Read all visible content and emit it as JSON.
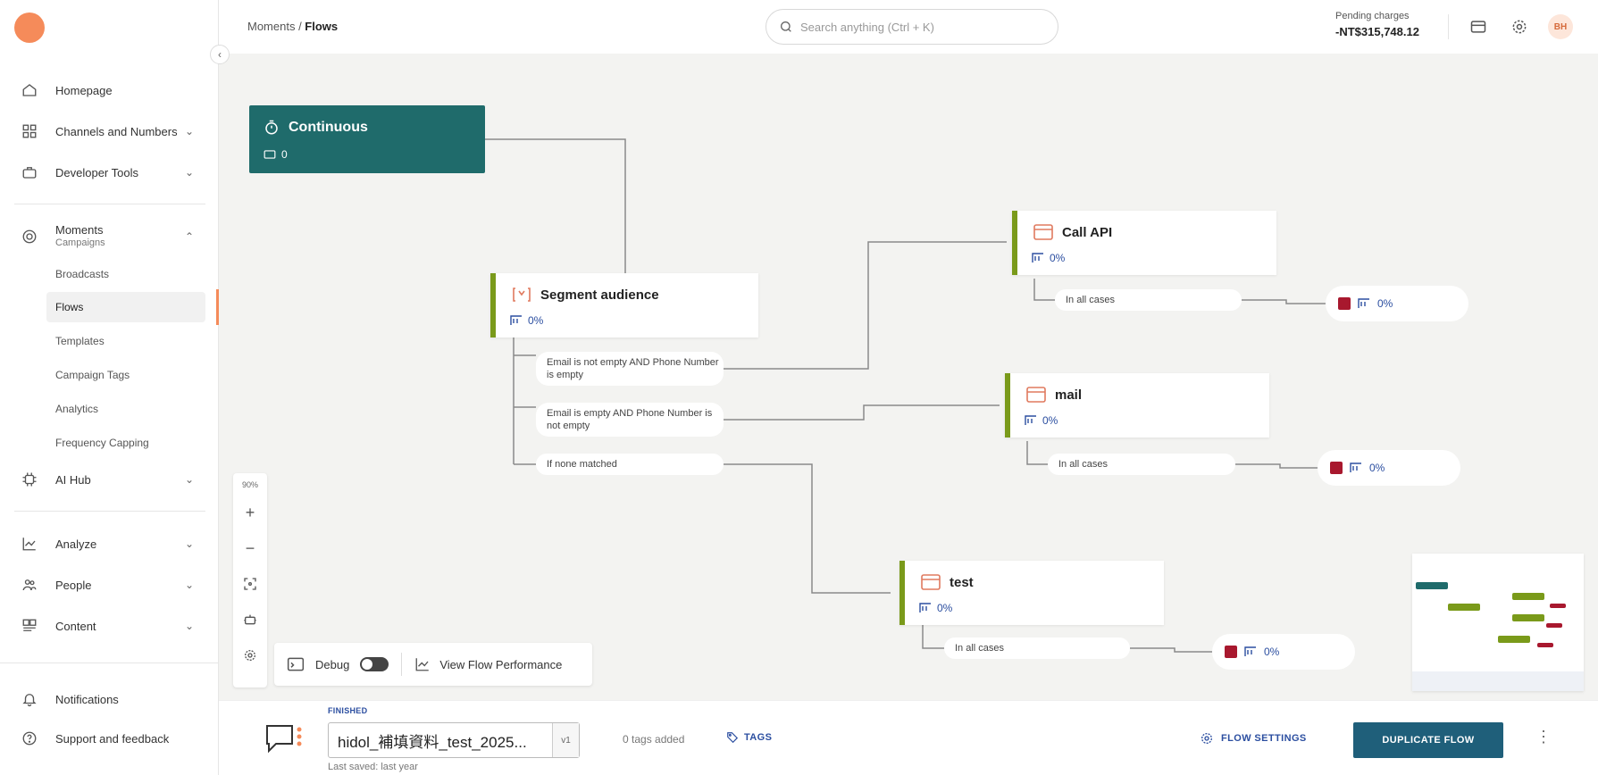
{
  "sidebar": {
    "items": [
      {
        "label": "Homepage",
        "icon": "home-icon"
      },
      {
        "label": "Channels and Numbers",
        "icon": "grid-icon"
      },
      {
        "label": "Developer Tools",
        "icon": "toolbox-icon"
      },
      {
        "label": "Moments",
        "sub": "Campaigns",
        "icon": "target-icon"
      },
      {
        "label": "AI Hub",
        "icon": "chip-icon"
      },
      {
        "label": "Analyze",
        "icon": "chart-icon"
      },
      {
        "label": "People",
        "icon": "people-icon"
      },
      {
        "label": "Content",
        "icon": "content-icon"
      }
    ],
    "moments_sub": [
      "Broadcasts",
      "Flows",
      "Templates",
      "Campaign Tags",
      "Analytics",
      "Frequency Capping"
    ],
    "bottom": [
      {
        "label": "Notifications",
        "icon": "bell-icon"
      },
      {
        "label": "Support and feedback",
        "icon": "help-icon"
      }
    ]
  },
  "header": {
    "breadcrumb_parent": "Moments / ",
    "breadcrumb_current": "Flows",
    "search_placeholder": "Search anything (Ctrl + K)",
    "pending_label": "Pending charges",
    "pending_value": "-NT$315,748.12",
    "avatar_initials": "BH"
  },
  "canvas": {
    "trigger": {
      "title": "Continuous",
      "count": "0"
    },
    "nodes": {
      "segment": {
        "title": "Segment audience",
        "stat": "0%"
      },
      "call_api": {
        "title": "Call API",
        "stat": "0%"
      },
      "mail": {
        "title": "mail",
        "stat": "0%"
      },
      "test": {
        "title": "test",
        "stat": "0%"
      }
    },
    "pills": {
      "cond1": "Email is not empty AND Phone Number is empty",
      "cond2": "Email is empty AND Phone Number is not empty",
      "cond3": "If none matched",
      "all1": "In all cases",
      "all2": "In all cases",
      "all3": "In all cases"
    },
    "end_stat": "0%",
    "zoom_level": "90%",
    "debug_label": "Debug",
    "performance_label": "View Flow Performance"
  },
  "footer": {
    "status": "FINISHED",
    "flow_name": "hidol_補填資料_test_2025...",
    "version": "v1",
    "last_saved": "Last saved: last year",
    "tags_count": "0 tags added",
    "tags_label": "TAGS",
    "settings_label": "FLOW SETTINGS",
    "duplicate_label": "DUPLICATE FLOW"
  },
  "colors": {
    "accent_orange": "#f58b5a",
    "trigger_teal": "#1f6b6b",
    "node_green": "#7a9a1a",
    "stop_red": "#a8182e",
    "link_blue": "#2b4ea0",
    "primary_button": "#1f5f7a"
  }
}
